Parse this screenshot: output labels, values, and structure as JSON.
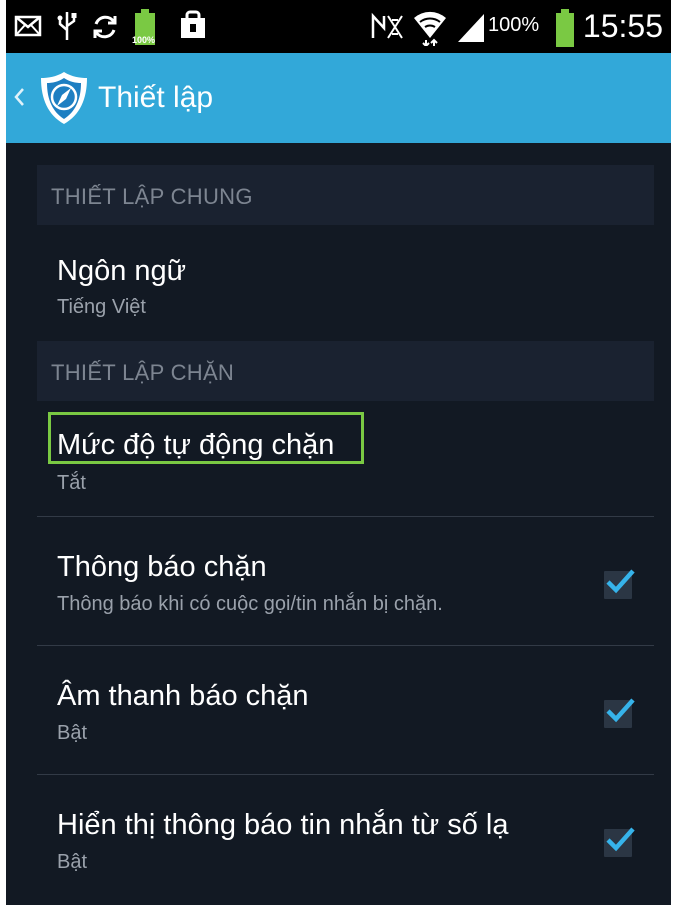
{
  "status_bar": {
    "battery_small_label": "100%",
    "battery_percent": "100%",
    "time": "15:55"
  },
  "action_bar": {
    "title": "Thiết lập"
  },
  "sections": [
    {
      "header": "THIẾT LẬP CHUNG",
      "items": [
        {
          "title": "Ngôn ngữ",
          "subtitle": "Tiếng Việt"
        }
      ]
    },
    {
      "header": "THIẾT LẬP CHẶN",
      "items": [
        {
          "title": "Mức độ tự động chặn",
          "subtitle": "Tắt"
        },
        {
          "title": "Thông báo chặn",
          "subtitle": "Thông báo khi có cuộc gọi/tin nhắn bị chặn.",
          "checked": true
        },
        {
          "title": "Âm thanh báo chặn",
          "subtitle": "Bật",
          "checked": true
        },
        {
          "title": "Hiển thị thông báo tin nhắn từ số lạ",
          "subtitle": "Bật",
          "checked": true
        }
      ]
    }
  ],
  "colors": {
    "action_bar": "#32a8d9",
    "background": "#121923",
    "section_header_bg": "#1a2230",
    "highlight": "#7ac943",
    "check": "#36b3ea"
  }
}
